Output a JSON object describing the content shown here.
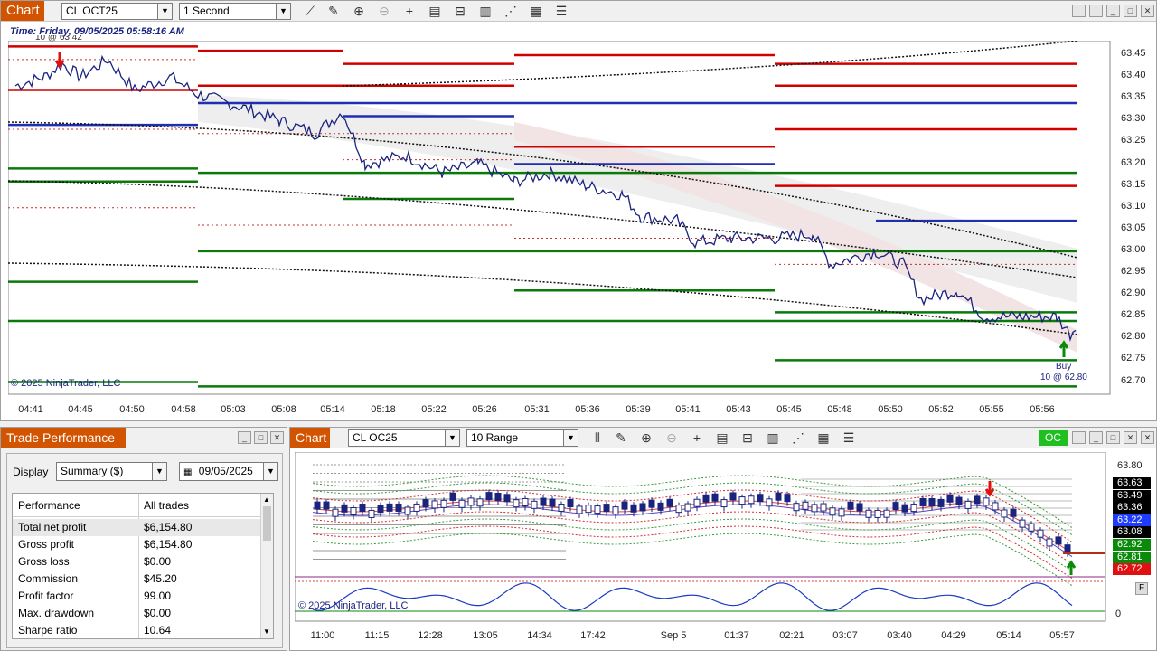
{
  "top_chart": {
    "title": "Chart",
    "instrument": "CL OCT25",
    "period": "1 Second",
    "time_label": "Time: Friday, 09/05/2025 05:58:16 AM",
    "copyright": "© 2025 NinjaTrader, LLC",
    "trade_marker_top": "10 @ 63.42",
    "trade_marker_buy_1": "Buy",
    "trade_marker_buy_2": "10 @ 62.80",
    "y_ticks": [
      "63.45",
      "63.40",
      "63.35",
      "63.30",
      "63.25",
      "63.20",
      "63.15",
      "63.10",
      "63.05",
      "63.00",
      "62.95",
      "62.90",
      "62.85",
      "62.80",
      "62.75",
      "62.70"
    ],
    "x_ticks": [
      "04:41",
      "04:45",
      "04:50",
      "04:58",
      "05:03",
      "05:08",
      "05:14",
      "05:18",
      "05:22",
      "05:26",
      "05:31",
      "05:36",
      "05:39",
      "05:41",
      "05:43",
      "05:45",
      "05:48",
      "05:50",
      "05:52",
      "05:55",
      "05:56"
    ]
  },
  "trade_perf": {
    "title": "Trade Performance",
    "display_label": "Display",
    "display_value": "Summary ($)",
    "date_value": "09/05/2025",
    "col1": "Performance",
    "col2": "All trades",
    "rows": [
      {
        "k": "Total net profit",
        "v": "$6,154.80"
      },
      {
        "k": "Gross profit",
        "v": "$6,154.80"
      },
      {
        "k": "Gross loss",
        "v": "$0.00"
      },
      {
        "k": "Commission",
        "v": "$45.20"
      },
      {
        "k": "Profit factor",
        "v": "99.00"
      },
      {
        "k": "Max. drawdown",
        "v": "$0.00"
      },
      {
        "k": "Sharpe ratio",
        "v": "10.64"
      }
    ]
  },
  "bottom_chart": {
    "title": "Chart",
    "instrument": "CL OC25",
    "period": "10 Range",
    "oc_badge": "OC",
    "copyright": "© 2025 NinjaTrader, LLC",
    "y_top": "63.80",
    "tags": [
      {
        "v": "63.63",
        "c": "#000000"
      },
      {
        "v": "63.49",
        "c": "#000000"
      },
      {
        "v": "63.36",
        "c": "#000000"
      },
      {
        "v": "63.22",
        "c": "#1e3cff"
      },
      {
        "v": "63.08",
        "c": "#000000"
      },
      {
        "v": "62.92",
        "c": "#0a8a0a"
      },
      {
        "v": "62.81",
        "c": "#0a8a0a"
      },
      {
        "v": "62.72",
        "c": "#e01010"
      }
    ],
    "osc_zero": "0",
    "x_ticks": [
      "11:00",
      "11:15",
      "12:28",
      "13:05",
      "14:34",
      "17:42",
      "Sep 5",
      "01:37",
      "02:21",
      "03:07",
      "03:40",
      "04:29",
      "05:14",
      "05:57"
    ]
  },
  "colors": {
    "accent": "#d35400",
    "price_line": "#1a237e",
    "buy": "#0a8a0a",
    "sell": "#e01010"
  }
}
